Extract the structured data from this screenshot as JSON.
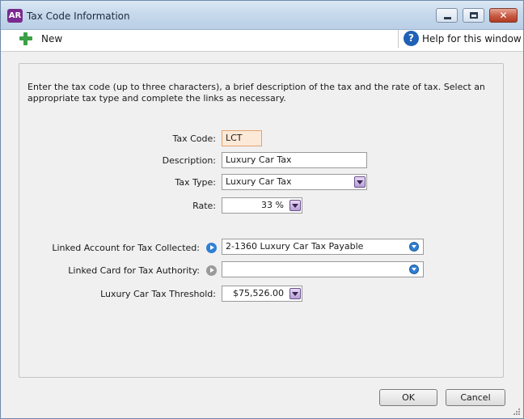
{
  "window": {
    "app_badge": "AR",
    "title": "Tax Code Information"
  },
  "toolbar": {
    "new_label": "New",
    "help_label": "Help for this window"
  },
  "form": {
    "instructions": "Enter the tax code (up to three characters), a brief description of the tax and the rate of tax. Select an appropriate tax type and complete the links as necessary.",
    "tax_code": {
      "label": "Tax Code:",
      "value": "LCT"
    },
    "description": {
      "label": "Description:",
      "value": "Luxury Car Tax"
    },
    "tax_type": {
      "label": "Tax Type:",
      "value": "Luxury Car Tax"
    },
    "rate": {
      "label": "Rate:",
      "value": "33 %"
    },
    "linked_account": {
      "label": "Linked Account for Tax Collected:",
      "value": "2-1360 Luxury Car Tax Payable"
    },
    "linked_card": {
      "label": "Linked Card for Tax Authority:",
      "value": ""
    },
    "threshold": {
      "label": "Luxury Car Tax Threshold:",
      "value": "$75,526.00"
    }
  },
  "buttons": {
    "ok": "OK",
    "cancel": "Cancel"
  },
  "colors": {
    "badge": "#7a2a8e",
    "help_icon": "#1f61b5",
    "new_icon": "#3ca046",
    "code_field_bg": "#fde9d8"
  }
}
